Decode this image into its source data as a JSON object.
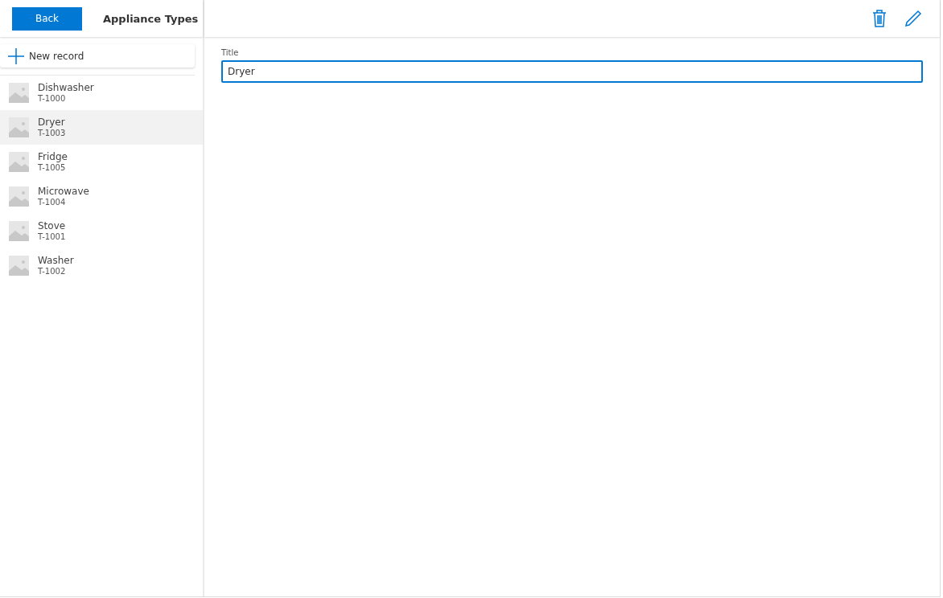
{
  "header": {
    "back_button": "Back",
    "title": "Appliance Types"
  },
  "new_record_button": "New record",
  "items": [
    {
      "name": "Dishwasher",
      "code": "T-1000",
      "selected": false
    },
    {
      "name": "Dryer",
      "code": "T-1003",
      "selected": true
    },
    {
      "name": "Fridge",
      "code": "T-1005",
      "selected": false
    },
    {
      "name": "Microwave",
      "code": "T-1004",
      "selected": false
    },
    {
      "name": "Stove",
      "code": "T-1001",
      "selected": false
    },
    {
      "name": "Washer",
      "code": "T-1002",
      "selected": false
    }
  ],
  "form": {
    "fields": [
      {
        "label": "Title",
        "value": "Dryer"
      }
    ]
  }
}
